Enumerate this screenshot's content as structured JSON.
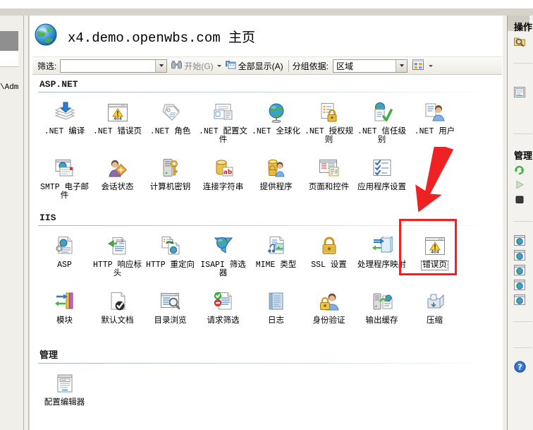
{
  "window": {
    "left_partial_text": "\\Adm",
    "page_title": "x4.demo.openwbs.com 主页",
    "globe_icon": "globe-icon"
  },
  "filter_bar": {
    "filter_label": "筛选:",
    "filter_value": "",
    "filter_placeholder": "",
    "go_label": "开始(G)",
    "go_icon": "binoculars-icon",
    "show_all_label": "全部显示(A)",
    "show_all_icon": "show-all-icon",
    "group_by_label": "分组依据:",
    "group_by_value": "区域",
    "view_icon": "view-mode-icon"
  },
  "groups": [
    {
      "name": "ASP.NET",
      "rows": [
        [
          {
            "label": ".NET 编译",
            "icon": "compile-stack-icon"
          },
          {
            "label": ".NET 错误页",
            "icon": "error-404-page-icon"
          },
          {
            "label": ".NET 角色",
            "icon": "roles-tag-icon"
          },
          {
            "label": ".NET 配置文件",
            "icon": "profile-config-icon"
          },
          {
            "label": ".NET 全球化",
            "icon": "globalization-globe-icon"
          },
          {
            "label": ".NET 授权规则",
            "icon": "authorization-lock-icon"
          },
          {
            "label": ".NET 信任级别",
            "icon": "trust-level-check-icon"
          },
          {
            "label": ".NET 用户",
            "icon": "users-icon"
          }
        ],
        [
          {
            "label": "SMTP 电子邮件",
            "icon": "smtp-email-icon"
          },
          {
            "label": "会话状态",
            "icon": "session-state-icon"
          },
          {
            "label": "计算机密钥",
            "icon": "machine-key-icon"
          },
          {
            "label": "连接字符串",
            "icon": "connection-string-icon"
          },
          {
            "label": "提供程序",
            "icon": "providers-icon"
          },
          {
            "label": "页面和控件",
            "icon": "pages-controls-icon"
          },
          {
            "label": "应用程序设置",
            "icon": "app-settings-icon"
          }
        ]
      ]
    },
    {
      "name": "IIS",
      "rows": [
        [
          {
            "label": "ASP",
            "icon": "asp-icon"
          },
          {
            "label": "HTTP 响应标头",
            "icon": "http-response-headers-icon"
          },
          {
            "label": "HTTP 重定向",
            "icon": "http-redirect-icon"
          },
          {
            "label": "ISAPI 筛选器",
            "icon": "isapi-filters-icon"
          },
          {
            "label": "MIME 类型",
            "icon": "mime-types-icon"
          },
          {
            "label": "SSL 设置",
            "icon": "ssl-lock-icon"
          },
          {
            "label": "处理程序映射",
            "icon": "handler-mappings-icon"
          },
          {
            "label": "错误页",
            "icon": "error-404-page-icon",
            "selected": true,
            "highlighted": true
          }
        ],
        [
          {
            "label": "模块",
            "icon": "modules-icon"
          },
          {
            "label": "默认文档",
            "icon": "default-document-icon"
          },
          {
            "label": "目录浏览",
            "icon": "directory-browsing-icon"
          },
          {
            "label": "请求筛选",
            "icon": "request-filtering-icon"
          },
          {
            "label": "日志",
            "icon": "logging-book-icon"
          },
          {
            "label": "身份验证",
            "icon": "authentication-icon"
          },
          {
            "label": "输出缓存",
            "icon": "output-caching-icon"
          },
          {
            "label": "压缩",
            "icon": "compression-icon"
          }
        ]
      ]
    },
    {
      "name": "管理",
      "rows": [
        [
          {
            "label": "配置编辑器",
            "icon": "configuration-editor-icon"
          }
        ]
      ]
    }
  ],
  "right_pane": {
    "title": "操作",
    "manage_title": "管理",
    "items": [
      {
        "icon": "explore-folder-icon"
      },
      {
        "icon": "edit-permissions-icon"
      },
      {
        "icon": "basic-settings-icon"
      },
      {
        "icon": "restart-icon"
      },
      {
        "icon": "start-icon"
      },
      {
        "icon": "stop-icon"
      },
      {
        "icon": "browse-website-icon"
      },
      {
        "icon": "browse-website-icon"
      },
      {
        "icon": "browse-website-icon"
      },
      {
        "icon": "browse-website-icon"
      },
      {
        "icon": "browse-website-icon"
      },
      {
        "icon": "help-icon"
      }
    ]
  },
  "annotation": {
    "color": "#ee2222",
    "arrow": "red-arrow-pointing-down",
    "box_target": "错误页"
  }
}
